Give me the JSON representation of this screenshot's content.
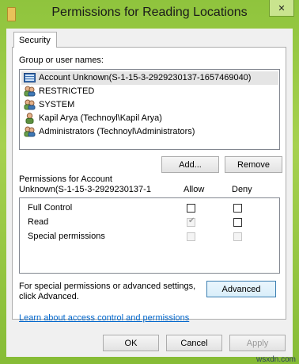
{
  "window": {
    "title": "Permissions for Reading Locations",
    "close_glyph": "✕"
  },
  "tabs": [
    {
      "label": "Security"
    }
  ],
  "groups": {
    "label": "Group or user names:",
    "items": [
      {
        "name": "Account Unknown(S-1-15-3-2929230137-1657469040)",
        "icon": "unknown-account-icon",
        "selected": true
      },
      {
        "name": "RESTRICTED",
        "icon": "users-group-icon"
      },
      {
        "name": "SYSTEM",
        "icon": "users-group-icon"
      },
      {
        "name": "Kapil Arya (Technoyl\\Kapil Arya)",
        "icon": "user-icon"
      },
      {
        "name": "Administrators (Technoyl\\Administrators)",
        "icon": "users-group-icon"
      }
    ]
  },
  "buttons": {
    "add": "Add...",
    "remove": "Remove",
    "advanced": "Advanced",
    "ok": "OK",
    "cancel": "Cancel",
    "apply": "Apply"
  },
  "permissions": {
    "label_line1": "Permissions for Account",
    "label_line2": "Unknown(S-1-15-3-2929230137-1",
    "allow_header": "Allow",
    "deny_header": "Deny",
    "rows": [
      {
        "name": "Full Control",
        "allow": false,
        "deny": false,
        "disabled": false
      },
      {
        "name": "Read",
        "allow": true,
        "deny": false,
        "disabled": true
      },
      {
        "name": "Special permissions",
        "allow": false,
        "deny": false,
        "disabled": true
      }
    ]
  },
  "special": {
    "line1": "For special permissions or advanced settings,",
    "line2": "click Advanced."
  },
  "learn_link": "Learn about access control and permissions",
  "watermark": "wsxdn.com"
}
